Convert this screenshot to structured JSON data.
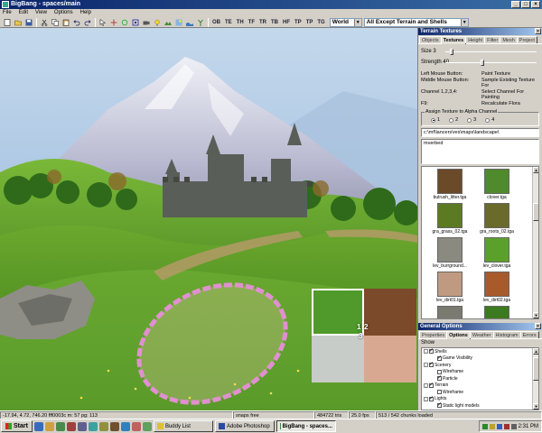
{
  "window": {
    "title": "BigBang - spaces/main",
    "buttons": [
      "_",
      "□",
      "×"
    ]
  },
  "menu": [
    "File",
    "Edit",
    "View",
    "Options",
    "Help"
  ],
  "toolbar": {
    "text_buttons": [
      "OB",
      "TE",
      "TH",
      "TF",
      "TR",
      "TB",
      "HF",
      "TP",
      "TP",
      "TG"
    ],
    "space_select": "World",
    "filter_select": "All Except Terrain and Shells"
  },
  "terrain_panel": {
    "title": "Terrain Textures",
    "tabs": [
      "Objects",
      "Textures",
      "Height",
      "Filter",
      "Mesh",
      "Project"
    ],
    "active_tab": "Textures",
    "size_label": "Size",
    "size_value": "3",
    "size_fraction": 0.05,
    "strength_label": "Strength",
    "strength_value": "40",
    "strength_fraction": 0.4,
    "help": [
      [
        "Left Mouse Button:",
        "Paint Texture"
      ],
      [
        "Middle Mouse Button:",
        "Sample Existing Texture For"
      ],
      [
        "Channel 1,2,3,4:",
        "Select Channel For Painting"
      ],
      [
        "F9:",
        "Recalculate Flora"
      ]
    ],
    "assign_label": "Assign Texture to Alpha Channel",
    "channels": [
      "1",
      "2",
      "3",
      "4"
    ],
    "selected_channel": "1",
    "path": "c:\\mf\\lancers\\res\\maps\\landscape\\",
    "subfolder": "mverbed",
    "textures": [
      {
        "name": "bulrush_litter.tga",
        "color": "#6b4a2a"
      },
      {
        "name": "clover.tga",
        "color": "#4f8a2c"
      },
      {
        "name": "gra_grass_02.tga",
        "color": "#5b7a22"
      },
      {
        "name": "gra_roots_02.tga",
        "color": "#6a6a2a"
      },
      {
        "name": "lev_burrground...",
        "color": "#8a8a80"
      },
      {
        "name": "lev_clover.tga",
        "color": "#5ca02c"
      },
      {
        "name": "lev_dirt01.tga",
        "color": "#c09a80"
      },
      {
        "name": "lev_dirt02.tga",
        "color": "#a85a2a"
      },
      {
        "name": "",
        "color": "#7a7a70"
      },
      {
        "name": "",
        "color": "#3c7a20"
      }
    ]
  },
  "general_panel": {
    "title": "General Options",
    "tabs": [
      "Properties",
      "Options",
      "Weather",
      "Histogram",
      "Errors"
    ],
    "active_tab": "Options",
    "show_label": "Show",
    "tree": [
      {
        "label": "Shells",
        "level": 0,
        "expander": "-",
        "checked": true
      },
      {
        "label": "Game Visibility",
        "level": 1,
        "checked": true
      },
      {
        "label": "Scenery",
        "level": 0,
        "expander": "-",
        "checked": true
      },
      {
        "label": "Wireframe",
        "level": 1,
        "checked": false
      },
      {
        "label": "Particle",
        "level": 1,
        "checked": true
      },
      {
        "label": "Terrain",
        "level": 0,
        "expander": "-",
        "checked": true
      },
      {
        "label": "Wireframe",
        "level": 1,
        "checked": false
      },
      {
        "label": "Lights",
        "level": 0,
        "expander": "-",
        "checked": true
      },
      {
        "label": "Static light models",
        "level": 1,
        "checked": true
      }
    ]
  },
  "overlay_numbers": [
    "1",
    "2",
    "3"
  ],
  "status": {
    "coords": "-17.94, 4.72, 746.20 fff0003c m: 57 pg: 113",
    "snap": "snaps free",
    "memory": "484722 tris",
    "fps": "25.0 fps",
    "chunks": "513 / 542 chunks loaded"
  },
  "taskbar": {
    "start": "Start",
    "tasks": [
      {
        "label": "Buddy List",
        "color": "#e0c030",
        "active": false
      },
      {
        "label": "Adobe Photoshop",
        "color": "#2a4aa0",
        "active": false
      },
      {
        "label": "BigBang - spaces...",
        "color": "#3a8a3a",
        "active": true
      }
    ],
    "clock": "2:31 PM"
  }
}
